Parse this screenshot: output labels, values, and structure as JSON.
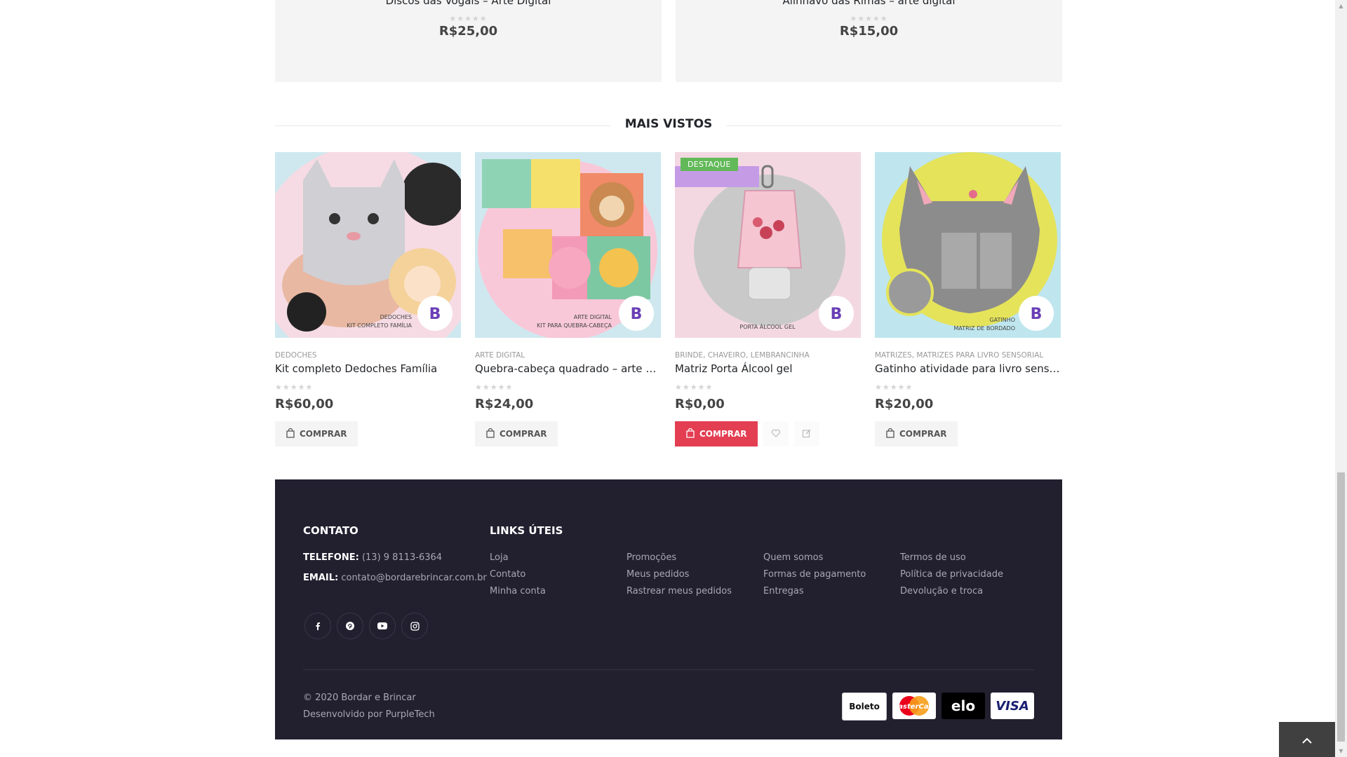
{
  "top_products": [
    {
      "name": "Discos das Vogais – Arte Digital",
      "price": "R$25,00",
      "rating": 0
    },
    {
      "name": "Alinhavo das Rimas – arte digital",
      "price": "R$15,00",
      "rating": 0
    }
  ],
  "section": {
    "title": "MAIS VISTOS"
  },
  "products": [
    {
      "category": "DEDOCHES",
      "name": "Kit completo Dedoches Família",
      "price": "R$60,00",
      "rating": 0,
      "button": "COMPRAR",
      "badge": ""
    },
    {
      "category": "ARTE DIGITAL",
      "name": "Quebra-cabeça quadrado – arte digital",
      "price": "R$24,00",
      "rating": 0,
      "button": "COMPRAR",
      "badge": ""
    },
    {
      "category": "BRINDE, CHAVEIRO, LEMBRANCINHA",
      "name": "Matriz Porta Álcool gel",
      "price": "R$0,00",
      "rating": 0,
      "button": "COMPRAR",
      "badge": "DESTAQUE"
    },
    {
      "category": "MATRIZES, MATRIZES PARA LIVRO SENSORIAL",
      "name": "Gatinho atividade para livro sensorial",
      "price": "R$20,00",
      "rating": 0,
      "button": "COMPRAR",
      "badge": ""
    }
  ],
  "footer": {
    "contact_title": "CONTATO",
    "phone_label": "TELEFONE:",
    "phone": "(13) 9 8113-6364",
    "email_label": "EMAIL:",
    "email": "contato@bordarebrincar.com.br",
    "links_title": "LINKS ÚTEIS",
    "links": [
      [
        "Loja",
        "Contato",
        "Minha conta"
      ],
      [
        "Promoções",
        "Meus pedidos",
        "Rastrear meus pedidos"
      ],
      [
        "Quem somos",
        "Formas de pagamento",
        "Entregas"
      ],
      [
        "Termos de uso",
        "Política de privacidade",
        "Devolução e troca"
      ]
    ],
    "social": [
      "facebook-icon",
      "pinterest-icon",
      "youtube-icon",
      "instagram-icon"
    ],
    "copyright": "© 2020 Bordar e Brincar",
    "developer": "Desenvolvido por PurpleTech",
    "payments": [
      "Boleto",
      "MasterCard",
      "elo",
      "VISA"
    ]
  },
  "colors": {
    "accent": "#e33e52",
    "badge": "#62b959",
    "footer_bg": "#221f2f"
  }
}
